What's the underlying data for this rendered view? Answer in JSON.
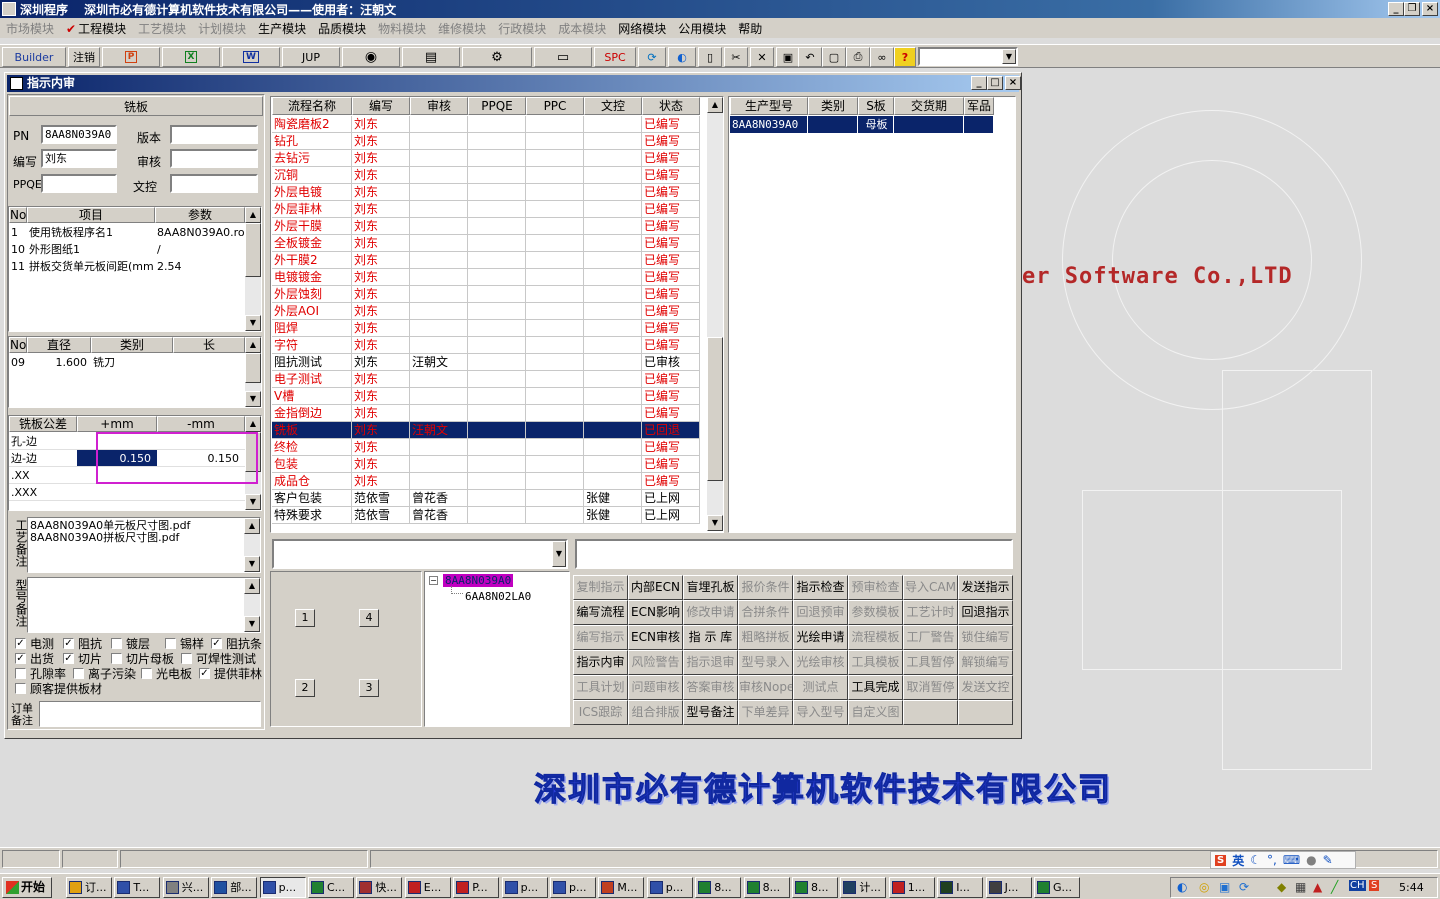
{
  "app_title": "深圳程序　 深圳市必有德计算机软件技术有限公司——使用者：汪朝文",
  "menu": [
    "市场模块",
    "工程模块",
    "工艺模块",
    "计划模块",
    "生产模块",
    "品质模块",
    "物料模块",
    "维修模块",
    "行政模块",
    "成本模块",
    "网络模块",
    "公用模块",
    "帮助"
  ],
  "menu_disabled": [
    true,
    false,
    true,
    true,
    false,
    false,
    true,
    true,
    true,
    true,
    false,
    false,
    false
  ],
  "toolbar": {
    "builder": "Builder",
    "logout": "注销",
    "ppt": "P",
    "excel": "X",
    "word": "W",
    "jup": "JUP",
    "spc": "SPC"
  },
  "window": {
    "title": "指示内审"
  },
  "left": {
    "section_title": "铣板",
    "pn_label": "PN",
    "pn_value": "8AA8N039A0",
    "version_label": "版本",
    "version_value": "",
    "editor_label": "编写",
    "editor_value": "刘东",
    "review_label": "审核",
    "review_value": "",
    "ppqe_label": "PPQE",
    "ppqe_value": "",
    "wenkong_label": "文控",
    "wenkong_value": "",
    "params_headers": [
      "No",
      "项目",
      "参数"
    ],
    "params_rows": [
      [
        "1",
        "使用铣板程序名1",
        "8AA8N039A0.rou"
      ],
      [
        "10",
        "外形图纸1",
        "/"
      ],
      [
        "11",
        "拼板交货单元板间距(mm",
        "2.54"
      ]
    ],
    "tools_headers": [
      "No",
      "直径",
      "类别",
      "长"
    ],
    "tools_rows": [
      [
        "09",
        "1.600",
        "铣刀",
        ""
      ]
    ],
    "tol_headers": [
      "铣板公差",
      "+mm",
      "-mm"
    ],
    "tol_rows": [
      [
        "孔-边",
        "",
        ""
      ],
      [
        "边-边",
        "0.150",
        "0.150"
      ],
      [
        ".XX",
        "",
        ""
      ],
      [
        ".XXX",
        "",
        ""
      ]
    ],
    "craft_note_label": "工艺备注",
    "craft_notes": [
      "8AA8N039A0单元板尺寸图.pdf",
      "8AA8N039A0拼板尺寸图.pdf"
    ],
    "model_note_label": "型号备注",
    "order_note_label": "订单备注",
    "checks": [
      {
        "label": "电测",
        "checked": true
      },
      {
        "label": "阻抗",
        "checked": true
      },
      {
        "label": "镀层",
        "checked": false
      },
      {
        "label": "锡样",
        "checked": false
      },
      {
        "label": "阻抗条",
        "checked": true
      },
      {
        "label": "出货",
        "checked": true
      },
      {
        "label": "切片",
        "checked": true
      },
      {
        "label": "切片母板",
        "checked": false
      },
      {
        "label": "可焊性测试",
        "checked": false
      },
      {
        "label": "孔隙率",
        "checked": false
      },
      {
        "label": "离子污染",
        "checked": false
      },
      {
        "label": "光电板",
        "checked": false
      },
      {
        "label": "提供菲林",
        "checked": true
      },
      {
        "label": "顾客提供板材",
        "checked": false
      }
    ]
  },
  "process": {
    "headers": [
      "流程名称",
      "编写",
      "审核",
      "PPQE",
      "PPC",
      "文控",
      "状态"
    ],
    "rows": [
      [
        "陶瓷磨板2",
        "刘东",
        "",
        "",
        "",
        "",
        "已编写"
      ],
      [
        "钻孔",
        "刘东",
        "",
        "",
        "",
        "",
        "已编写"
      ],
      [
        "去钻污",
        "刘东",
        "",
        "",
        "",
        "",
        "已编写"
      ],
      [
        "沉铜",
        "刘东",
        "",
        "",
        "",
        "",
        "已编写"
      ],
      [
        "外层电镀",
        "刘东",
        "",
        "",
        "",
        "",
        "已编写"
      ],
      [
        "外层菲林",
        "刘东",
        "",
        "",
        "",
        "",
        "已编写"
      ],
      [
        "外层干膜",
        "刘东",
        "",
        "",
        "",
        "",
        "已编写"
      ],
      [
        "全板镀金",
        "刘东",
        "",
        "",
        "",
        "",
        "已编写"
      ],
      [
        "外干膜2",
        "刘东",
        "",
        "",
        "",
        "",
        "已编写"
      ],
      [
        "电镀镀金",
        "刘东",
        "",
        "",
        "",
        "",
        "已编写"
      ],
      [
        "外层蚀刻",
        "刘东",
        "",
        "",
        "",
        "",
        "已编写"
      ],
      [
        "外层AOI",
        "刘东",
        "",
        "",
        "",
        "",
        "已编写"
      ],
      [
        "阻焊",
        "刘东",
        "",
        "",
        "",
        "",
        "已编写"
      ],
      [
        "字符",
        "刘东",
        "",
        "",
        "",
        "",
        "已编写"
      ],
      [
        "阻抗测试",
        "刘东",
        "汪朝文",
        "",
        "",
        "",
        "已审核"
      ],
      [
        "电子测试",
        "刘东",
        "",
        "",
        "",
        "",
        "已编写"
      ],
      [
        "V槽",
        "刘东",
        "",
        "",
        "",
        "",
        "已编写"
      ],
      [
        "金指倒边",
        "刘东",
        "",
        "",
        "",
        "",
        "已编写"
      ],
      [
        "铣板",
        "刘东",
        "汪朝文",
        "",
        "",
        "",
        "已回退"
      ],
      [
        "终检",
        "刘东",
        "",
        "",
        "",
        "",
        "已编写"
      ],
      [
        "包装",
        "刘东",
        "",
        "",
        "",
        "",
        "已编写"
      ],
      [
        "成品仓",
        "刘东",
        "",
        "",
        "",
        "",
        "已编写"
      ],
      [
        "客户包装",
        "范依雪",
        "曾花香",
        "",
        "",
        "张健",
        "已上网"
      ],
      [
        "特殊要求",
        "范依雪",
        "曾花香",
        "",
        "",
        "张健",
        "已上网"
      ]
    ],
    "row_red": [
      true,
      true,
      true,
      true,
      true,
      true,
      true,
      true,
      true,
      true,
      true,
      true,
      true,
      true,
      false,
      true,
      true,
      true,
      true,
      true,
      true,
      true,
      false,
      false
    ],
    "selected_row": 18
  },
  "product": {
    "headers": [
      "生产型号",
      "类别",
      "S板",
      "交货期",
      "军品"
    ],
    "rows": [
      [
        "8AA8N039A0",
        "",
        "母板",
        "",
        ""
      ]
    ]
  },
  "tree": {
    "root": "8AA8N039A0",
    "child": "6AA8N02LA0"
  },
  "num_buttons": [
    "1",
    "4",
    "2",
    "3"
  ],
  "action_buttons": [
    {
      "label": "复制指示",
      "enabled": false
    },
    {
      "label": "内部ECN",
      "enabled": true
    },
    {
      "label": "盲埋孔板",
      "enabled": true
    },
    {
      "label": "报价条件",
      "enabled": false
    },
    {
      "label": "指示检查",
      "enabled": true
    },
    {
      "label": "预审检查",
      "enabled": false
    },
    {
      "label": "导入CAM",
      "enabled": false
    },
    {
      "label": "发送指示",
      "enabled": true
    },
    {
      "label": "编写流程",
      "enabled": true
    },
    {
      "label": "ECN影响",
      "enabled": true
    },
    {
      "label": "修改申请",
      "enabled": false
    },
    {
      "label": "合拼条件",
      "enabled": false
    },
    {
      "label": "回退预审",
      "enabled": false
    },
    {
      "label": "参数模板",
      "enabled": false
    },
    {
      "label": "工艺计时",
      "enabled": false
    },
    {
      "label": "回退指示",
      "enabled": true
    },
    {
      "label": "编写指示",
      "enabled": false
    },
    {
      "label": "ECN审核",
      "enabled": true
    },
    {
      "label": "指 示 库",
      "enabled": true
    },
    {
      "label": "粗略拼板",
      "enabled": false
    },
    {
      "label": "光绘申请",
      "enabled": true
    },
    {
      "label": "流程模板",
      "enabled": false
    },
    {
      "label": "工厂警告",
      "enabled": false
    },
    {
      "label": "锁住编写",
      "enabled": false
    },
    {
      "label": "指示内审",
      "enabled": true
    },
    {
      "label": "风险警告",
      "enabled": false
    },
    {
      "label": "指示退审",
      "enabled": false
    },
    {
      "label": "型号录入",
      "enabled": false
    },
    {
      "label": "光绘审核",
      "enabled": false
    },
    {
      "label": "工具模板",
      "enabled": false
    },
    {
      "label": "工具暂停",
      "enabled": false
    },
    {
      "label": "解锁编写",
      "enabled": false
    },
    {
      "label": "工具计划",
      "enabled": false
    },
    {
      "label": "问题审核",
      "enabled": false
    },
    {
      "label": "答案审核",
      "enabled": false
    },
    {
      "label": "审核Nope",
      "enabled": false
    },
    {
      "label": "测试点",
      "enabled": false
    },
    {
      "label": "工具完成",
      "enabled": true
    },
    {
      "label": "取消暂停",
      "enabled": false
    },
    {
      "label": "发送文控",
      "enabled": false
    },
    {
      "label": "ICS跟踪",
      "enabled": false
    },
    {
      "label": "组合排版",
      "enabled": false
    },
    {
      "label": "型号备注",
      "enabled": true
    },
    {
      "label": "下单差异",
      "enabled": false
    },
    {
      "label": "导入型号",
      "enabled": false
    },
    {
      "label": "自定义图",
      "enabled": false
    },
    {
      "label": "",
      "enabled": false
    },
    {
      "label": "",
      "enabled": false
    }
  ],
  "background": {
    "company_en": "er Software Co.,LTD",
    "company_cn": "深圳市必有德计算机软件技术有限公司"
  },
  "ime": {
    "lang": "英"
  },
  "taskbar": {
    "start": "开始",
    "items": [
      "订...",
      "T...",
      "兴...",
      "部...",
      "p...",
      "C...",
      "快...",
      "E...",
      "P...",
      "p...",
      "p...",
      "M...",
      "p...",
      "8...",
      "8...",
      "8...",
      "计...",
      "1...",
      "I...",
      "J...",
      "G..."
    ],
    "clock": "5:44"
  }
}
